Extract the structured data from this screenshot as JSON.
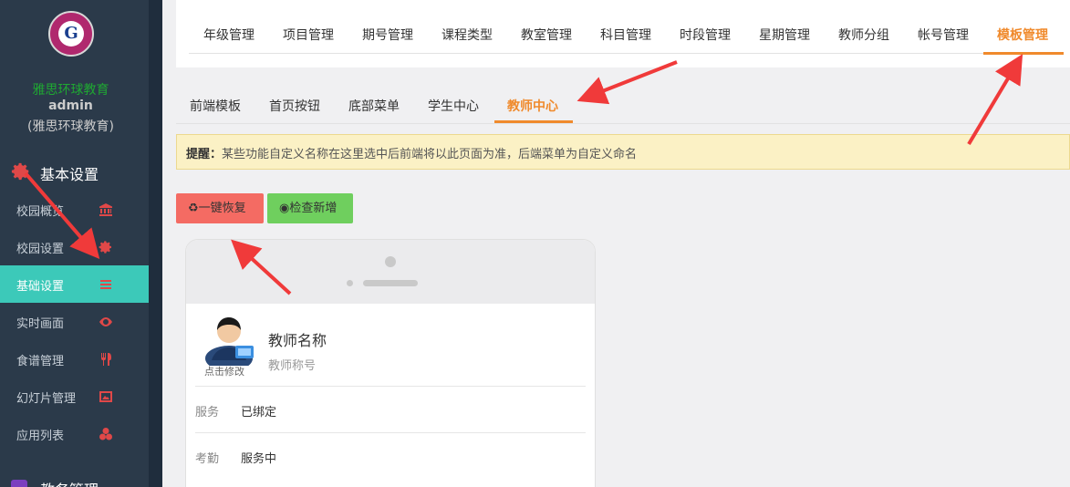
{
  "sidebar": {
    "logo_text": "G",
    "org_name": "雅思环球教育",
    "user": "admin",
    "org_sub": "(雅思环球教育)",
    "section_title": "基本设置",
    "items": [
      {
        "label": "校园概览",
        "icon": "bank-icon"
      },
      {
        "label": "校园设置",
        "icon": "gear-icon"
      },
      {
        "label": "基础设置",
        "icon": "list-icon",
        "active": true
      },
      {
        "label": "实时画面",
        "icon": "eye-icon"
      },
      {
        "label": "食谱管理",
        "icon": "cutlery-icon"
      },
      {
        "label": "幻灯片管理",
        "icon": "image-icon"
      },
      {
        "label": "应用列表",
        "icon": "apps-icon"
      }
    ],
    "bottom_section": "教务管理"
  },
  "topnav": {
    "tabs": [
      "年级管理",
      "项目管理",
      "期号管理",
      "课程类型",
      "教室管理",
      "科目管理",
      "时段管理",
      "星期管理",
      "教师分组",
      "帐号管理",
      "模板管理"
    ],
    "active": "模板管理"
  },
  "subtabs": {
    "tabs": [
      "前端模板",
      "首页按钮",
      "底部菜单",
      "学生中心",
      "教师中心"
    ],
    "active": "教师中心"
  },
  "alert": {
    "label": "提醒：",
    "text": "某些功能自定义名称在这里选中后前端将以此页面为准，后端菜单为自定义命名"
  },
  "buttons": {
    "restore": "♻一键恢复",
    "check": "◉检查新增"
  },
  "preview": {
    "avatar_caption": "点击修改",
    "teacher_name": "教师名称",
    "teacher_title": "教师称号",
    "rows": [
      {
        "key": "服务",
        "value": "已绑定"
      },
      {
        "key": "考勤",
        "value": "服务中"
      }
    ]
  },
  "colors": {
    "accent": "#f08a2c",
    "sidebar_active": "#3cc9b9",
    "danger": "#f46b63",
    "success": "#6fcf5e",
    "arrow": "#f03a3a"
  }
}
